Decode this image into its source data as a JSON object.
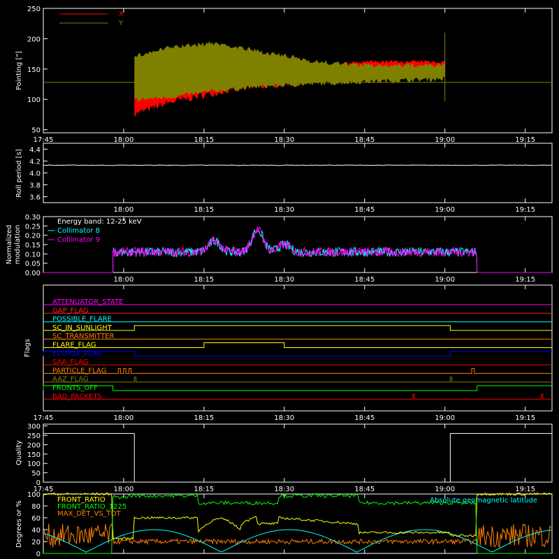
{
  "chart_data": [
    {
      "id": "pointing",
      "type": "line",
      "ylabel": "Pointing [\"]",
      "ylim": [
        45,
        250
      ],
      "yticks": [
        50,
        100,
        150,
        200,
        250
      ],
      "x_minutes_after_1745": [
        0,
        95
      ],
      "xticks": [
        "17:45",
        "18:00",
        "18:15",
        "18:30",
        "18:45",
        "19:00",
        "19:15"
      ],
      "legend": [
        {
          "name": "X",
          "color": "#ff0000"
        },
        {
          "name": "Y",
          "color": "#808000"
        }
      ],
      "series": [
        {
          "name": "X",
          "color": "#ff0000",
          "segments": [
            {
              "x": [
                17,
                24,
                35,
                50,
                60,
                75
              ],
              "low": [
                70,
                90,
                110,
                125,
                135,
                140
              ],
              "high": [
                150,
                150,
                150,
                155,
                165,
                165
              ]
            }
          ]
        },
        {
          "name": "Y",
          "color": "#808000",
          "segments": [
            {
              "x": [
                17,
                24,
                32,
                42,
                52,
                60,
                75
              ],
              "low": [
                95,
                100,
                110,
                118,
                122,
                125,
                130
              ],
              "high": [
                175,
                190,
                197,
                180,
                165,
                160,
                160
              ]
            }
          ]
        }
      ],
      "baseline": 128,
      "spike_x": 75,
      "spike": [
        97,
        210
      ]
    },
    {
      "id": "roll",
      "type": "line",
      "ylabel": "Roll period [s]",
      "ylim": [
        3.5,
        4.5
      ],
      "yticks": [
        3.6,
        3.8,
        4.0,
        4.2,
        4.4
      ],
      "yticks_labels": [
        "3.6",
        "3.8",
        "4.0",
        "4.2",
        "4.4"
      ],
      "xticks": [
        "18:00",
        "18:15",
        "18:30",
        "18:45",
        "19:00",
        "19:15"
      ],
      "value": 4.13
    },
    {
      "id": "modulation",
      "type": "line",
      "ylabel": "Normalized modulation",
      "ylabel_lines": [
        "Normalized",
        "modulation"
      ],
      "ylim": [
        0,
        0.3
      ],
      "yticks": [
        0.0,
        0.05,
        0.1,
        0.15,
        0.2,
        0.25,
        0.3
      ],
      "yticks_labels": [
        "0.00",
        "0.05",
        "0.10",
        "0.15",
        "0.20",
        "0.25",
        "0.30"
      ],
      "xticks": [
        "18:00",
        "18:15",
        "18:30",
        "18:45",
        "19:00",
        "19:15"
      ],
      "legend_title": "Energy band: 12-25 keV",
      "series": [
        {
          "name": "Collimator 8",
          "color": "#00ffff"
        },
        {
          "name": "Collimator 9",
          "color": "#ff00ff"
        }
      ],
      "x_range": [
        13,
        81
      ],
      "base": 0.11,
      "bumps": [
        {
          "x": 32,
          "h": 0.06
        },
        {
          "x": 40,
          "h": 0.12
        },
        {
          "x": 45,
          "h": 0.04
        }
      ]
    },
    {
      "id": "flags",
      "type": "line",
      "ylabel": "Flags",
      "xticks": [
        "17:45",
        "18:00",
        "18:15",
        "18:30",
        "18:45",
        "19:00",
        "19:15"
      ],
      "flags": [
        {
          "name": "ATTENUATOR_STATE",
          "color": "#ff00ff",
          "steps": []
        },
        {
          "name": "GAP_FLAG",
          "color": "#ff2020",
          "steps": []
        },
        {
          "name": "POSSIBLE_FLARE",
          "color": "#00ffff",
          "steps": []
        },
        {
          "name": "SC_IN_SUNLIGHT",
          "color": "#ffff00",
          "steps": [
            [
              17,
              1
            ],
            [
              76,
              0
            ]
          ]
        },
        {
          "name": "SC_TRANSMITTER",
          "color": "#ff8000",
          "steps": []
        },
        {
          "name": "FLARE_FLAG",
          "color": "#ffff00",
          "steps": [
            [
              30,
              1
            ],
            [
              45,
              0
            ]
          ]
        },
        {
          "name": "ECLIPSE_FLAG",
          "color": "#0000ff",
          "steps": [
            [
              0,
              1
            ],
            [
              17,
              0
            ],
            [
              76,
              1
            ]
          ]
        },
        {
          "name": "SAA_FLAG",
          "color": "#ff0000",
          "steps": []
        },
        {
          "name": "PARTICLE_FLAG",
          "color": "#ff8000",
          "steps": [
            [
              14,
              1
            ],
            [
              14.4,
              0
            ],
            [
              15,
              1
            ],
            [
              15.4,
              0
            ],
            [
              16,
              1
            ],
            [
              16.4,
              0
            ],
            [
              80,
              1
            ],
            [
              80.5,
              0
            ]
          ]
        },
        {
          "name": "AAZ_FLAG",
          "color": "#808000",
          "steps": [
            [
              17,
              1
            ],
            [
              17.3,
              0
            ],
            [
              76,
              1
            ],
            [
              76.3,
              0
            ]
          ]
        },
        {
          "name": "FRONTS_OFF",
          "color": "#00ff00",
          "steps": [
            [
              0,
              1
            ],
            [
              13,
              0
            ],
            [
              81,
              1
            ]
          ]
        },
        {
          "name": "BAD_PACKETS",
          "color": "#ff0000",
          "steps": [
            [
              69,
              1
            ],
            [
              69.3,
              0
            ],
            [
              93,
              1
            ],
            [
              93.3,
              0
            ]
          ]
        }
      ]
    },
    {
      "id": "quality",
      "type": "line",
      "ylabel": "Quality",
      "ylim": [
        0,
        310
      ],
      "yticks": [
        0,
        50,
        100,
        150,
        200,
        250,
        300
      ],
      "xticks": [
        "17:45",
        "18:00",
        "18:15",
        "18:30",
        "18:45",
        "19:00",
        "19:15"
      ],
      "steps": [
        [
          0,
          260
        ],
        [
          17,
          0
        ],
        [
          76,
          260
        ]
      ]
    },
    {
      "id": "ratios",
      "type": "line",
      "ylabel": "Degrees or %",
      "ylim": [
        0,
        100
      ],
      "yticks": [
        0,
        20,
        40,
        60,
        80,
        100
      ],
      "legend": [
        {
          "name": "FRONT_RATIO",
          "color": "#ffff00"
        },
        {
          "name": "FRONT_RATIO_1225",
          "color": "#00ff00"
        },
        {
          "name": "MAX_DET_VS_TOT",
          "color": "#ff8000"
        }
      ],
      "right_label": "Absolute geomagnetic latitude",
      "right_label_color": "#00ffff"
    }
  ]
}
